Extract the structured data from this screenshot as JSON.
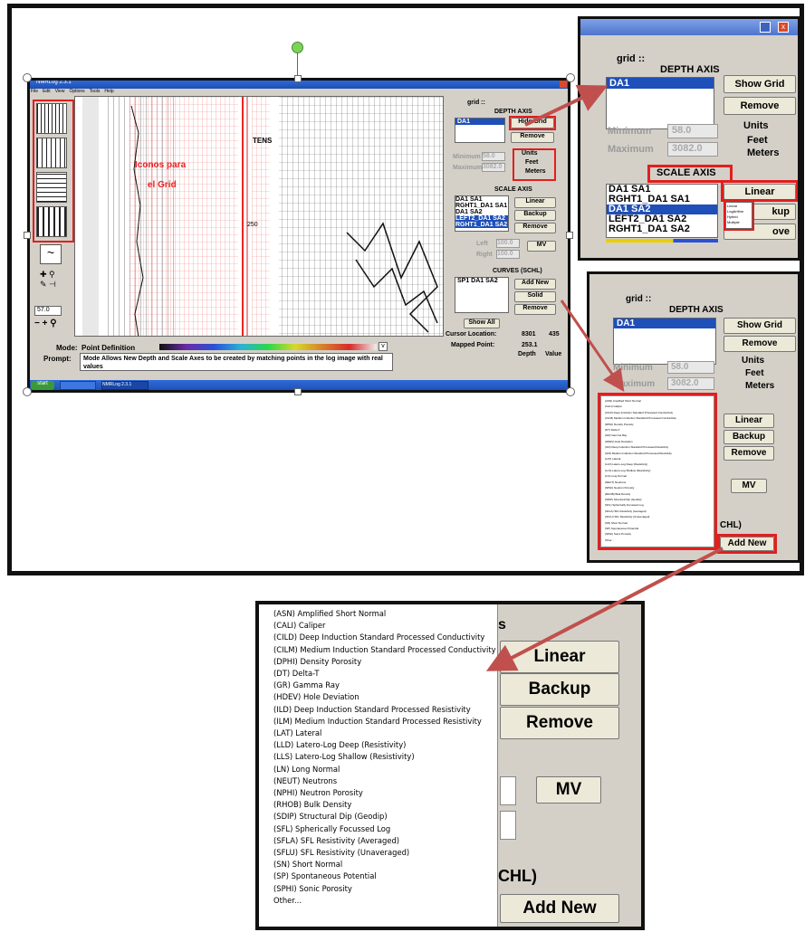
{
  "main_window": {
    "title": "NMRLog 2.3.1",
    "menu": [
      "File",
      "Edit",
      "View",
      "Options",
      "Tools",
      "Help"
    ],
    "annotation": [
      "Iconos para",
      "el Grid"
    ],
    "track_label": "TENS",
    "depth_tick": "250",
    "zoom_value": "57.0",
    "mode_label": "Mode:",
    "mode_value": "Point Definition",
    "prompt_label": "Prompt:",
    "prompt_text": "Mode Allows New Depth and Scale Axes to be created by matching points in the log image with real values",
    "cursor_label": "Cursor Location:",
    "cursor_depth": "8301",
    "cursor_value": "435",
    "mapped_label": "Mapped Point:",
    "mapped_value": "253.1",
    "depth_col": "Depth",
    "value_col": "Value",
    "taskbar": [
      "start",
      "",
      "NMRLog 2.3.1"
    ],
    "panel": {
      "grid_label": "grid ::",
      "depth_axis": "DEPTH AXIS",
      "depth_items": [
        "DA1"
      ],
      "hide_grid": "Hide Grid",
      "remove": "Remove",
      "units": "Units",
      "feet": "Feet",
      "meters": "Meters",
      "minimum": "Minimum",
      "maximum": "Maximum",
      "min_val": "58.0",
      "max_val": "3082.0",
      "scale_axis": "SCALE AXIS",
      "scale_items": [
        "DA1 SA1",
        "RGHT1_DA1 SA1",
        "DA1 SA2",
        "LEFT2_DA1 SA2",
        "RGHT1_DA1 SA2"
      ],
      "linear": "Linear",
      "backup": "Backup",
      "left_field": "Left",
      "right_field": "Right",
      "left_val": "100.0",
      "right_val": "100.0",
      "mv": "MV",
      "curves": "CURVES (SCHL)",
      "curve_items": [
        "SP1 DA1 SA2"
      ],
      "add_new": "Add New",
      "solid": "Solid",
      "show_all": "Show All"
    }
  },
  "zoom1": {
    "grid_label": "grid ::",
    "depth_axis": "DEPTH AXIS",
    "depth_items": [
      "DA1"
    ],
    "show_grid": "Show Grid",
    "remove": "Remove",
    "units": "Units",
    "feet": "Feet",
    "meters": "Meters",
    "minimum": "Minimum",
    "maximum": "Maximum",
    "min_val": "58.0",
    "max_val": "3082.0",
    "scale_axis": "SCALE AXIS",
    "scale_items": [
      "DA1 SA1",
      "RGHT1_DA1 SA1",
      "DA1 SA2",
      "LEFT2_DA1 SA2",
      "RGHT1_DA1 SA2"
    ],
    "linear": "Linear",
    "backup_partial": "kup",
    "remove_partial": "ove",
    "scale_options": [
      "Linear",
      "LogArithm",
      "Hybrid",
      "Multiple"
    ]
  },
  "zoom2": {
    "grid_label": "grid ::",
    "depth_axis": "DEPTH AXIS",
    "depth_items": [
      "DA1"
    ],
    "show_grid": "Show Grid",
    "remove": "Remove",
    "units": "Units",
    "feet": "Feet",
    "meters": "Meters",
    "minimum": "Minimum",
    "maximum": "Maximum",
    "min_val": "58.0",
    "max_val": "3082.0",
    "linear": "Linear",
    "backup": "Backup",
    "mv": "MV",
    "curves_partial": "CHL)",
    "add_new": "Add New"
  },
  "zoom3": {
    "partial_s": "s",
    "linear": "Linear",
    "backup": "Backup",
    "remove": "Remove",
    "mv": "MV",
    "curves_partial": "CHL)",
    "add_new": "Add New",
    "curve_types": [
      "(ASN) Amplified Short Normal",
      "(CALI) Caliper",
      "(CILD) Deep Induction Standard Processed Conductivity",
      "(CILM) Medium Induction Standard Processed Conductivity",
      "(DPHI) Density Porosity",
      "(DT) Delta-T",
      "(GR) Gamma Ray",
      "(HDEV) Hole Deviation",
      "(ILD) Deep Induction Standard Processed Resistivity",
      "(ILM) Medium Induction Standard Processed Resistivity",
      "(LAT) Lateral",
      "(LLD) Latero-Log Deep (Resistivity)",
      "(LLS) Latero-Log Shallow (Resistivity)",
      "(LN) Long Normal",
      "(NEUT) Neutrons",
      "(NPHI) Neutron Porosity",
      "(RHOB) Bulk Density",
      "(SDIP) Structural Dip (Geodip)",
      "(SFL) Spherically Focussed Log",
      "(SFLA) SFL Resistivity (Averaged)",
      "(SFLU) SFL Resistivity (Unaveraged)",
      "(SN) Short Normal",
      "(SP) Spontaneous Potential",
      "(SPHI) Sonic Porosity",
      "Other..."
    ]
  },
  "colors": {
    "highlight_red": "#e21e1e",
    "selection_blue": "#1f4fb8",
    "window_gray": "#d4d0c8",
    "arrow": "#c0504d"
  }
}
